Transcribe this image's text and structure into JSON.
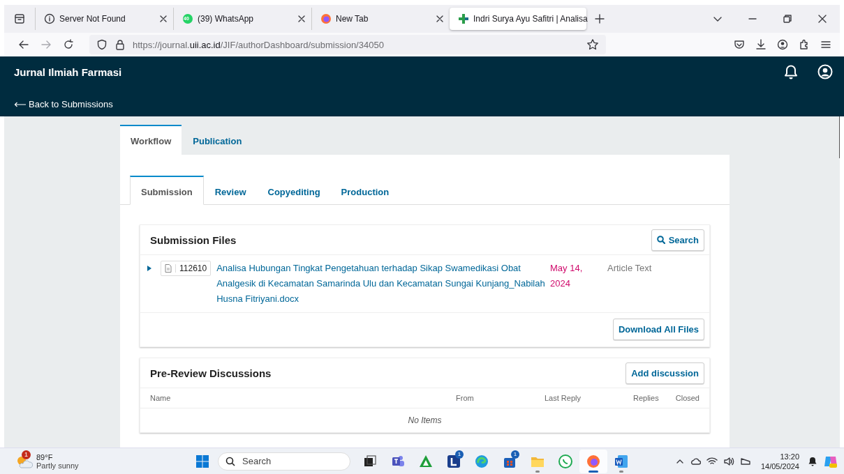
{
  "browser": {
    "tabs": [
      {
        "label": "Server Not Found",
        "kind": "info",
        "selected": false
      },
      {
        "label": "(39) WhatsApp",
        "kind": "whatsapp",
        "badge": "40",
        "selected": false
      },
      {
        "label": "New Tab",
        "kind": "firefox",
        "selected": false
      },
      {
        "label": "Indri Surya Ayu Safitri | Analisa",
        "kind": "cross",
        "selected": true
      }
    ],
    "url": {
      "before": "https://journal.",
      "domain": "uii.ac.id",
      "after": "/JIF/authorDashboard/submission/34050"
    }
  },
  "header": {
    "title": "Jurnal Ilmiah Farmasi",
    "back_link": "Back to Submissions"
  },
  "workflow_tabs": [
    {
      "label": "Workflow",
      "selected": true
    },
    {
      "label": "Publication",
      "selected": false
    }
  ],
  "stage_tabs": [
    {
      "label": "Submission",
      "selected": true
    },
    {
      "label": "Review",
      "selected": false
    },
    {
      "label": "Copyediting",
      "selected": false
    },
    {
      "label": "Production",
      "selected": false
    }
  ],
  "submission_files": {
    "title": "Submission Files",
    "search_button": "Search",
    "files": [
      {
        "id": "112610",
        "name": "Analisa Hubungan Tingkat Pengetahuan terhadap Sikap Swamedikasi Obat Analgesik di Kecamatan Samarinda Ulu dan Kecamatan Sungai Kunjang_Nabilah Husna Fitriyani.docx",
        "date": "May 14, 2024",
        "type": "Article Text",
        "expanded": false
      }
    ],
    "download_button": "Download All Files"
  },
  "discussions": {
    "title": "Pre-Review Discussions",
    "add_button": "Add discussion",
    "columns": [
      "Name",
      "From",
      "Last Reply",
      "Replies",
      "Closed"
    ],
    "empty_text": "No Items"
  },
  "taskbar": {
    "weather": {
      "badge": "1",
      "temperature": "89°F",
      "condition": "Partly sunny"
    },
    "search_placeholder": "Search",
    "apps": [
      {
        "kind": "taskview",
        "running": false,
        "selected": false
      },
      {
        "kind": "teams",
        "running": false,
        "selected": false
      },
      {
        "kind": "triangle",
        "running": false,
        "selected": false
      },
      {
        "kind": "letter",
        "badge": "1",
        "running": false,
        "selected": false
      },
      {
        "kind": "edge",
        "running": false,
        "selected": false
      },
      {
        "kind": "store",
        "badge": "1",
        "running": false,
        "selected": false
      },
      {
        "kind": "folder",
        "running": true,
        "selected": false
      },
      {
        "kind": "whatsapp",
        "running": false,
        "selected": false
      },
      {
        "kind": "firefox",
        "running": true,
        "selected": true
      },
      {
        "kind": "word",
        "running": true,
        "selected": false
      }
    ],
    "time": "13:20",
    "date": "14/05/2024"
  }
}
